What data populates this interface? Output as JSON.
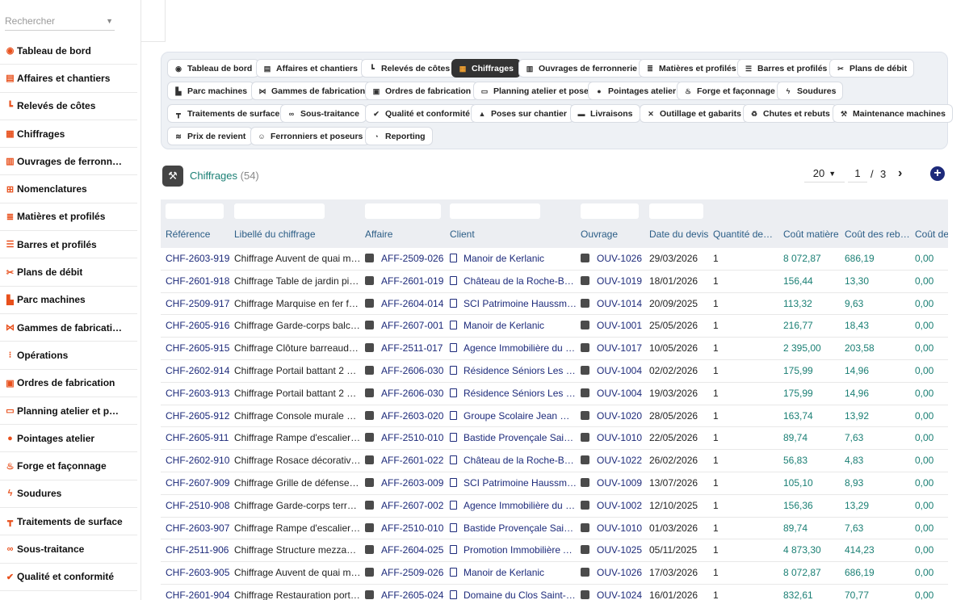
{
  "search": {
    "placeholder": "Rechercher"
  },
  "sidebar": {
    "items": [
      {
        "icon": "dashboard-icon",
        "glyph": "◉",
        "label": "Tableau de bord"
      },
      {
        "icon": "briefcase-icon",
        "glyph": "▤",
        "label": "Affaires et chantiers"
      },
      {
        "icon": "ruler-icon",
        "glyph": "┗",
        "label": "Relevés de côtes"
      },
      {
        "icon": "calculator-icon",
        "glyph": "▦",
        "label": "Chiffrages"
      },
      {
        "icon": "gate-icon",
        "glyph": "▥",
        "label": "Ouvrages de ferronn…"
      },
      {
        "icon": "sitemap-icon",
        "glyph": "⊞",
        "label": "Nomenclatures"
      },
      {
        "icon": "layers-icon",
        "glyph": "≣",
        "label": "Matières et profilés"
      },
      {
        "icon": "bars-icon",
        "glyph": "☰",
        "label": "Barres et profilés"
      },
      {
        "icon": "scissors-icon",
        "glyph": "✂",
        "label": "Plans de débit"
      },
      {
        "icon": "industry-icon",
        "glyph": "▙",
        "label": "Parc machines"
      },
      {
        "icon": "flow-icon",
        "glyph": "⋈",
        "label": "Gammes de fabricati…"
      },
      {
        "icon": "list-icon",
        "glyph": "⁝",
        "label": "Opérations"
      },
      {
        "icon": "clipboard-icon",
        "glyph": "▣",
        "label": "Ordres de fabrication"
      },
      {
        "icon": "calendar-icon",
        "glyph": "▭",
        "label": "Planning atelier et p…"
      },
      {
        "icon": "clock-icon",
        "glyph": "●",
        "label": "Pointages atelier"
      },
      {
        "icon": "fire-icon",
        "glyph": "♨",
        "label": "Forge et façonnage"
      },
      {
        "icon": "bolt-icon",
        "glyph": "ϟ",
        "label": "Soudures"
      },
      {
        "icon": "paint-roller-icon",
        "glyph": "┳",
        "label": "Traitements de surface"
      },
      {
        "icon": "handshake-icon",
        "glyph": "∞",
        "label": "Sous-traitance"
      },
      {
        "icon": "check-badge-icon",
        "glyph": "✔",
        "label": "Qualité et conformité"
      }
    ]
  },
  "nav_pills": [
    {
      "label": "Tableau de bord",
      "icon": "dashboard-icon",
      "glyph": "◉",
      "active": false
    },
    {
      "label": "Affaires et chantiers",
      "icon": "briefcase-icon",
      "glyph": "▤",
      "active": false
    },
    {
      "label": "Relevés de côtes",
      "icon": "ruler-icon",
      "glyph": "┗",
      "active": false
    },
    {
      "label": "Chiffrages",
      "icon": "calculator-icon",
      "glyph": "▦",
      "active": true
    },
    {
      "label": "Ouvrages de ferronnerie",
      "icon": "gate-icon",
      "glyph": "▥",
      "active": false
    },
    {
      "label": "Matières et profilés",
      "icon": "layers-icon",
      "glyph": "≣",
      "active": false
    },
    {
      "label": "Barres et profilés",
      "icon": "bars-icon",
      "glyph": "☰",
      "active": false
    },
    {
      "label": "Plans de débit",
      "icon": "scissors-icon",
      "glyph": "✂",
      "active": false
    },
    {
      "label": "Parc machines",
      "icon": "industry-icon",
      "glyph": "▙",
      "active": false
    },
    {
      "label": "Gammes de fabrication",
      "icon": "flow-icon",
      "glyph": "⋈",
      "active": false
    },
    {
      "label": "Ordres de fabrication",
      "icon": "clipboard-icon",
      "glyph": "▣",
      "active": false
    },
    {
      "label": "Planning atelier et pose",
      "icon": "calendar-icon",
      "glyph": "▭",
      "active": false
    },
    {
      "label": "Pointages atelier",
      "icon": "clock-icon",
      "glyph": "●",
      "active": false
    },
    {
      "label": "Forge et façonnage",
      "icon": "fire-icon",
      "glyph": "♨",
      "active": false
    },
    {
      "label": "Soudures",
      "icon": "bolt-icon",
      "glyph": "ϟ",
      "active": false
    },
    {
      "label": "Traitements de surface",
      "icon": "paint-roller-icon",
      "glyph": "┳",
      "active": false
    },
    {
      "label": "Sous-traitance",
      "icon": "handshake-icon",
      "glyph": "∞",
      "active": false
    },
    {
      "label": "Qualité et conformité",
      "icon": "check-badge-icon",
      "glyph": "✔",
      "active": false
    },
    {
      "label": "Poses sur chantier",
      "icon": "hard-hat-icon",
      "glyph": "▲",
      "active": false
    },
    {
      "label": "Livraisons",
      "icon": "truck-icon",
      "glyph": "▬",
      "active": false
    },
    {
      "label": "Outillage et gabarits",
      "icon": "tools-icon",
      "glyph": "✕",
      "active": false
    },
    {
      "label": "Chutes et rebuts",
      "icon": "recycle-icon",
      "glyph": "♻",
      "active": false
    },
    {
      "label": "Maintenance machines",
      "icon": "wrench-icon",
      "glyph": "⚒",
      "active": false
    },
    {
      "label": "Prix de revient",
      "icon": "coins-icon",
      "glyph": "≋",
      "active": false
    },
    {
      "label": "Ferronniers et poseurs",
      "icon": "users-icon",
      "glyph": "☺",
      "active": false
    },
    {
      "label": "Reporting",
      "icon": "pie-chart-icon",
      "glyph": "◔",
      "active": false
    }
  ],
  "page": {
    "title": "Chiffrages",
    "count": "(54)"
  },
  "pagination": {
    "page_size": "20",
    "current": "1",
    "separator": "/",
    "total": "3",
    "next": "›",
    "add": "+"
  },
  "table": {
    "columns": [
      "Référence",
      "Libellé du chiffrage",
      "Affaire",
      "Client",
      "Ouvrage",
      "Date du devis",
      "Quantité de…",
      "Coût matière",
      "Coût des reb…",
      "Coût de"
    ],
    "rows": [
      [
        "CHF-2603-919",
        "Chiffrage Auvent de quai m…",
        "AFF-2509-026",
        "Manoir de Kerlanic",
        "OUV-1026",
        "29/03/2026",
        "1",
        "8 072,87",
        "686,19",
        "0,00"
      ],
      [
        "CHF-2601-918",
        "Chiffrage Table de jardin piè…",
        "AFF-2601-019",
        "Château de la Roche-Be…",
        "OUV-1019",
        "18/01/2026",
        "1",
        "156,44",
        "13,30",
        "0,00"
      ],
      [
        "CHF-2509-917",
        "Chiffrage Marquise en fer fo…",
        "AFF-2604-014",
        "SCI Patrimoine Haussm…",
        "OUV-1014",
        "20/09/2025",
        "1",
        "113,32",
        "9,63",
        "0,00"
      ],
      [
        "CHF-2605-916",
        "Chiffrage Garde-corps balco…",
        "AFF-2607-001",
        "Manoir de Kerlanic",
        "OUV-1001",
        "25/05/2026",
        "1",
        "216,77",
        "18,43",
        "0,00"
      ],
      [
        "CHF-2605-915",
        "Chiffrage Clôture barreaudé…",
        "AFF-2511-017",
        "Agence Immobilière du …",
        "OUV-1017",
        "10/05/2026",
        "1",
        "2 395,00",
        "203,58",
        "0,00"
      ],
      [
        "CHF-2602-914",
        "Chiffrage Portail battant 2 v…",
        "AFF-2606-030",
        "Résidence Séniors Les …",
        "OUV-1004",
        "02/02/2026",
        "1",
        "175,99",
        "14,96",
        "0,00"
      ],
      [
        "CHF-2603-913",
        "Chiffrage Portail battant 2 v…",
        "AFF-2606-030",
        "Résidence Séniors Les …",
        "OUV-1004",
        "19/03/2026",
        "1",
        "175,99",
        "14,96",
        "0,00"
      ],
      [
        "CHF-2605-912",
        "Chiffrage Console murale à …",
        "AFF-2603-020",
        "Groupe Scolaire Jean M…",
        "OUV-1020",
        "28/05/2026",
        "1",
        "163,74",
        "13,92",
        "0,00"
      ],
      [
        "CHF-2605-911",
        "Chiffrage Rampe d'escalier i…",
        "AFF-2510-010",
        "Bastide Provençale Sain…",
        "OUV-1010",
        "22/05/2026",
        "1",
        "89,74",
        "7,63",
        "0,00"
      ],
      [
        "CHF-2602-910",
        "Chiffrage Rosace décorativ…",
        "AFF-2601-022",
        "Château de la Roche-Be…",
        "OUV-1022",
        "26/02/2026",
        "1",
        "56,83",
        "4,83",
        "0,00"
      ],
      [
        "CHF-2607-909",
        "Chiffrage Grille de défense f…",
        "AFF-2603-009",
        "SCI Patrimoine Haussm…",
        "OUV-1009",
        "13/07/2026",
        "1",
        "105,10",
        "8,93",
        "0,00"
      ],
      [
        "CHF-2510-908",
        "Chiffrage Garde-corps terra…",
        "AFF-2607-002",
        "Agence Immobilière du …",
        "OUV-1002",
        "12/10/2025",
        "1",
        "156,36",
        "13,29",
        "0,00"
      ],
      [
        "CHF-2603-907",
        "Chiffrage Rampe d'escalier i…",
        "AFF-2510-010",
        "Bastide Provençale Sain…",
        "OUV-1010",
        "01/03/2026",
        "1",
        "89,74",
        "7,63",
        "0,00"
      ],
      [
        "CHF-2511-906",
        "Chiffrage Structure mezzani…",
        "AFF-2604-025",
        "Promotion Immobilière A…",
        "OUV-1025",
        "05/11/2025",
        "1",
        "4 873,30",
        "414,23",
        "0,00"
      ],
      [
        "CHF-2603-905",
        "Chiffrage Auvent de quai m…",
        "AFF-2509-026",
        "Manoir de Kerlanic",
        "OUV-1026",
        "17/03/2026",
        "1",
        "8 072,87",
        "686,19",
        "0,00"
      ],
      [
        "CHF-2601-904",
        "Chiffrage Restauration porta…",
        "AFF-2605-024",
        "Domaine du Clos Saint-…",
        "OUV-1024",
        "16/01/2026",
        "1",
        "832,61",
        "70,77",
        "0,00"
      ]
    ]
  },
  "colors": {
    "accent": "#1a7f74",
    "link": "#1d2a7a",
    "sidebar_icon": "#e8501c",
    "active_pill": "#333333"
  }
}
